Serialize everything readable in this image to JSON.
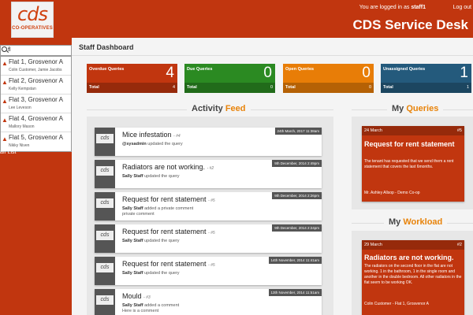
{
  "header": {
    "logo_text": "cds",
    "logo_sub": "CO-OPERATIVES",
    "login_prefix": "You are logged in as",
    "login_user": "staff1",
    "logout": "Log out",
    "app_title": "CDS Service Desk",
    "brand_color": "#c1360f"
  },
  "sidebar": {
    "search_value": "fl",
    "results": [
      {
        "title": "Flat 1, Grosvenor A",
        "sub": "Colin Customer, Jamie Jacobs"
      },
      {
        "title": "Flat 2, Grosvenor A",
        "sub": "Kelly Kempstan"
      },
      {
        "title": "Flat 3, Grosvenor A",
        "sub": "Lee Leveson"
      },
      {
        "title": "Flat 4, Grosvenor A",
        "sub": "Mallory Mason"
      },
      {
        "title": "Flat 5, Grosvenor A",
        "sub": "Nikky Niven"
      }
    ],
    "staff_list": "aff List"
  },
  "main": {
    "page_title": "Staff Dashboard",
    "stats": [
      {
        "label": "Overdue Queries",
        "value": "4",
        "total_label": "Total",
        "total": "4",
        "color": "#c1360f"
      },
      {
        "label": "Due Queries",
        "value": "0",
        "total_label": "Total",
        "total": "0",
        "color": "#2b8a22"
      },
      {
        "label": "Open Queries",
        "value": "0",
        "total_label": "Total",
        "total": "0",
        "color": "#e87d07"
      },
      {
        "label": "Unassigned Queries",
        "value": "1",
        "total_label": "Total",
        "total": "1",
        "color": "#245a7c"
      }
    ],
    "feed_heading": {
      "part1": "Activity",
      "part2": "Feed"
    },
    "feed": [
      {
        "title": "Mice infestation",
        "ref": "- #4",
        "actor": "@sysadmin",
        "action": "updated the query",
        "extra": "",
        "date": "24th March, 2017 11:38am"
      },
      {
        "title": "Radiators are not working.",
        "ref": "- #2",
        "actor": "Sally Staff",
        "action": "updated the query",
        "extra": "",
        "date": "9th December, 2014 2:49pm"
      },
      {
        "title": "Request for rent statement",
        "ref": "- #5",
        "actor": "Sally Staff",
        "action": "added a private comment",
        "extra": "private comment",
        "date": "9th December, 2014 2:26pm"
      },
      {
        "title": "Request for rent statement",
        "ref": "- #5",
        "actor": "Sally Staff",
        "action": "updated the query",
        "extra": "",
        "date": "9th December, 2014 2:24pm"
      },
      {
        "title": "Request for rent statement",
        "ref": "- #5",
        "actor": "Sally Staff",
        "action": "updated the query",
        "extra": "",
        "date": "14th November, 2014 11:41am"
      },
      {
        "title": "Mould",
        "ref": "- #3",
        "actor": "Sally Staff",
        "action": "added a comment",
        "extra": "Here is a comment",
        "date": "13th November, 2014 11:51am"
      }
    ],
    "queries_heading": {
      "part1": "My",
      "part2": "Queries"
    },
    "my_queries": [
      {
        "date": "24 March",
        "num": "#5",
        "title": "Request for rent statement",
        "body": "The tenant has requested that we send them a rent statement that covers the last 6months.",
        "footer": "Mr. Ashley Allsop - Demo Co-op"
      }
    ],
    "workload_heading": {
      "part1": "My",
      "part2": "Workload"
    },
    "my_workload": [
      {
        "date": "29 March",
        "num": "#2",
        "title": "Radiators are not working.",
        "body": "The radiators on the second floor in the flat are not working. 1 in the bathroom, 1 in the single room and another in the double bedroom. All other radiators in the flat seem to be working OK.",
        "footer": "Colin Customer - Flat 1, Grosvenor A"
      }
    ]
  }
}
